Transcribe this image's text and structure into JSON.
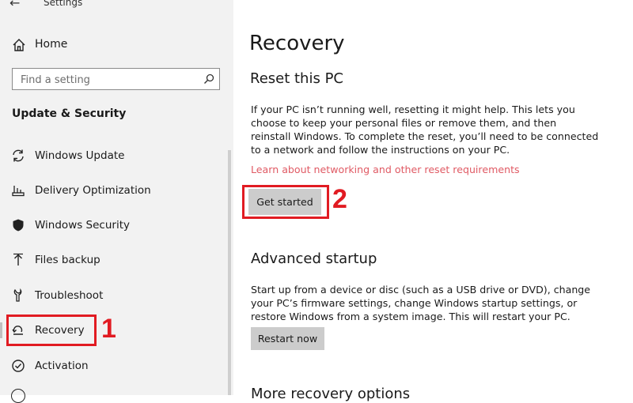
{
  "window": {
    "title": "Settings"
  },
  "sidebar": {
    "home_label": "Home",
    "search_placeholder": "Find a setting",
    "section_title": "Update & Security",
    "items": [
      {
        "label": "Windows Update",
        "icon": "sync-icon"
      },
      {
        "label": "Delivery Optimization",
        "icon": "delivery-icon"
      },
      {
        "label": "Windows Security",
        "icon": "shield-icon"
      },
      {
        "label": "Files backup",
        "icon": "upload-icon"
      },
      {
        "label": "Troubleshoot",
        "icon": "wrench-icon"
      },
      {
        "label": "Recovery",
        "icon": "recovery-icon",
        "selected": true
      },
      {
        "label": "Activation",
        "icon": "check-circle-icon"
      }
    ]
  },
  "main": {
    "page_title": "Recovery",
    "reset": {
      "title": "Reset this PC",
      "description": "If your PC isn’t running well, resetting it might help. This lets you choose to keep your personal files or remove them, and then reinstall Windows. To complete the reset, you’ll need to be connected to a network and follow the instructions on your PC.",
      "link": "Learn about networking and other reset requirements",
      "button": "Get started"
    },
    "advanced": {
      "title": "Advanced startup",
      "description": "Start up from a device or disc (such as a USB drive or DVD), change your PC’s firmware settings, change Windows startup settings, or restore Windows from a system image. This will restart your PC.",
      "button": "Restart now"
    },
    "more_title": "More recovery options"
  },
  "annotations": {
    "callout_1": "1",
    "callout_2": "2"
  },
  "colors": {
    "accent_red": "#e11b22",
    "link": "#e05a64",
    "button_bg": "#cccccc",
    "sidebar_bg": "#f2f2f2"
  }
}
